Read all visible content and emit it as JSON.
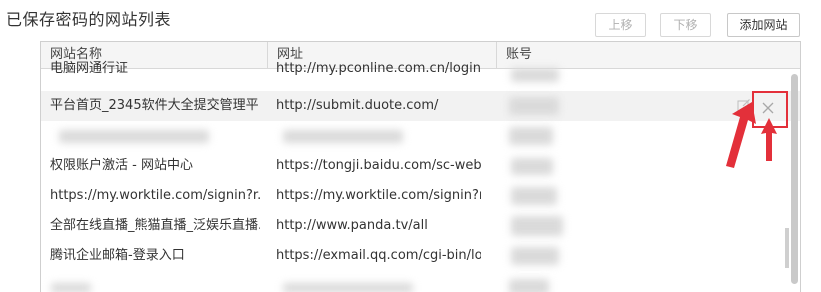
{
  "title": "已保存密码的网站列表",
  "toolbar": {
    "move_up_label": "上移",
    "move_down_label": "下移",
    "add_site_label": "添加网站"
  },
  "table": {
    "headers": [
      "网站名称",
      "网址",
      "账号"
    ],
    "rows": [
      {
        "name": "电脑网通行证",
        "url": "http://my.pconline.com.cn/login.j...",
        "account": ""
      },
      {
        "name": "平台首页_2345软件大全提交管理平...",
        "url": "http://submit.duote.com/",
        "account": ""
      },
      {
        "name": "",
        "url": "",
        "account": ""
      },
      {
        "name": "权限账户激活 - 网站中心",
        "url": "https://tongji.baidu.com/sc-web/...",
        "account": ""
      },
      {
        "name": "https://my.worktile.com/signin?r...",
        "url": "https://my.worktile.com/signin?r...",
        "account": ""
      },
      {
        "name": "全部在线直播_熊猫直播_泛娱乐直播...",
        "url": "http://www.panda.tv/all",
        "account": ""
      },
      {
        "name": "腾讯企业邮箱-登录入口",
        "url": "https://exmail.qq.com/cgi-bin/lo...",
        "account": ""
      }
    ]
  },
  "icons": {
    "edit": "edit-icon",
    "delete": "close-icon"
  },
  "colors": {
    "annotation_red": "#e3303a",
    "row_highlight": "#f2f2f2"
  }
}
